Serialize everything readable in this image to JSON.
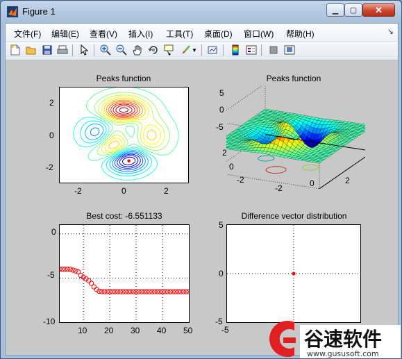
{
  "window": {
    "title": "Figure 1",
    "min_label": "▁",
    "max_label": "▢",
    "close_label": "✕"
  },
  "menu": [
    "文件(F)",
    "编辑(E)",
    "查看(V)",
    "插入(I)",
    "工具(T)",
    "桌面(D)",
    "窗口(W)",
    "帮助(H)"
  ],
  "toolbar_icons": [
    "new-figure-icon",
    "open-file-icon",
    "save-icon",
    "print-icon",
    "select-arrow-icon",
    "zoom-in-icon",
    "zoom-out-icon",
    "pan-hand-icon",
    "rotate-3d-icon",
    "data-cursor-icon",
    "brush-icon",
    "link-plot-icon",
    "colorbar-icon",
    "legend-icon",
    "hide-plot-tools-icon",
    "show-plot-tools-icon"
  ],
  "plots": {
    "contour": {
      "title": "Peaks function",
      "xticks": [
        "-2",
        "0",
        "2"
      ],
      "yticks": [
        "2",
        "0",
        "-2"
      ]
    },
    "surface": {
      "title": "Peaks function",
      "zticks": [
        "5",
        "0",
        "-5"
      ],
      "yticks": [
        "2",
        "0",
        "-2"
      ],
      "xticks": [
        "-2",
        "0",
        "2"
      ]
    },
    "cost": {
      "title": "Best cost: -6.551133",
      "yticks": [
        "0",
        "-5",
        "-10"
      ],
      "xticks": [
        "10",
        "20",
        "30",
        "40",
        "50"
      ]
    },
    "diff": {
      "title": "Difference vector distribution",
      "yticks": [
        "5",
        "0",
        "-5"
      ],
      "xticks": [
        "-5"
      ]
    }
  },
  "chart_data": [
    {
      "type": "contour",
      "title": "Peaks function",
      "xlim": [
        -3,
        3
      ],
      "ylim": [
        -3,
        3
      ],
      "marker": {
        "x": 0.23,
        "y": -1.63,
        "color": "#ff0000"
      }
    },
    {
      "type": "surface",
      "title": "Peaks function",
      "xlim": [
        -3,
        3
      ],
      "ylim": [
        -3,
        3
      ],
      "zlim": [
        -8,
        8
      ]
    },
    {
      "type": "scatter",
      "title": "Best cost: -6.551133",
      "xlim": [
        1,
        50
      ],
      "ylim": [
        -10,
        1
      ],
      "grid": true,
      "color": "#ff0000",
      "x": [
        1,
        2,
        3,
        4,
        5,
        6,
        7,
        8,
        9,
        10,
        11,
        12,
        13,
        14,
        15,
        16,
        17,
        18,
        19,
        20,
        21,
        22,
        23,
        24,
        25,
        26,
        27,
        28,
        29,
        30,
        31,
        32,
        33,
        34,
        35,
        36,
        37,
        38,
        39,
        40,
        41,
        42,
        43,
        44,
        45,
        46,
        47,
        48,
        49,
        50
      ],
      "y": [
        -4,
        -4,
        -4,
        -4,
        -4,
        -4.1,
        -4.2,
        -4.3,
        -4.7,
        -4.9,
        -5.1,
        -5.3,
        -5.6,
        -6.0,
        -6.3,
        -6.5,
        -6.55,
        -6.55,
        -6.55,
        -6.55,
        -6.55,
        -6.55,
        -6.55,
        -6.55,
        -6.55,
        -6.55,
        -6.55,
        -6.55,
        -6.55,
        -6.55,
        -6.55,
        -6.55,
        -6.55,
        -6.55,
        -6.55,
        -6.55,
        -6.55,
        -6.55,
        -6.55,
        -6.55,
        -6.55,
        -6.55,
        -6.55,
        -6.55,
        -6.55,
        -6.55,
        -6.55,
        -6.55,
        -6.55,
        -6.55
      ]
    },
    {
      "type": "scatter",
      "title": "Difference vector distribution",
      "xlim": [
        -5,
        5
      ],
      "ylim": [
        -5,
        5
      ],
      "grid": true,
      "color": "#ff0000",
      "x": [
        0
      ],
      "y": [
        0
      ]
    }
  ],
  "watermark": {
    "brand": "谷速软件",
    "url": "www.gususoft.com",
    "color": "#e02020"
  }
}
